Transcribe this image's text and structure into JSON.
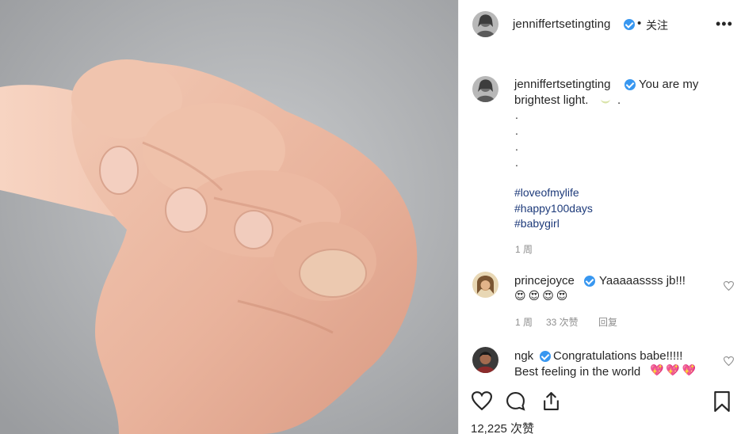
{
  "post": {
    "username": "jenniffertsetingting",
    "follow_label": "关注",
    "separator": "•"
  },
  "caption": {
    "username": "jenniffertsetingting",
    "line1": "You are my",
    "line2": "brightest light.",
    "line2_tail": ".",
    "dots": [
      ".",
      ".",
      ".",
      "."
    ],
    "hashtags": [
      "#loveofmylife",
      "#happy100days",
      "#babygirl"
    ],
    "meta": "1 周"
  },
  "comments": [
    {
      "username": "princejoyce",
      "text": "Yaaaaassss jb!!!",
      "emoji_line": "😍😍😍😍",
      "meta_age": "1 周",
      "meta_likes": "33 次赞",
      "meta_reply": "回复"
    },
    {
      "username": "ngk",
      "text": "Congratulations babe!!!!!",
      "line2": "Best feeling in the world",
      "emoji_line": "💖💖💖"
    }
  ],
  "actions": {
    "like_icon": "heart-icon",
    "comment_icon": "comment-icon",
    "share_icon": "share-icon",
    "save_icon": "bookmark-icon"
  },
  "likes_label": "12,225 次赞",
  "colors": {
    "verified": "#3897f0",
    "hashtag": "#1d3a7a",
    "meta": "#8e8e8e",
    "text": "#262626"
  }
}
